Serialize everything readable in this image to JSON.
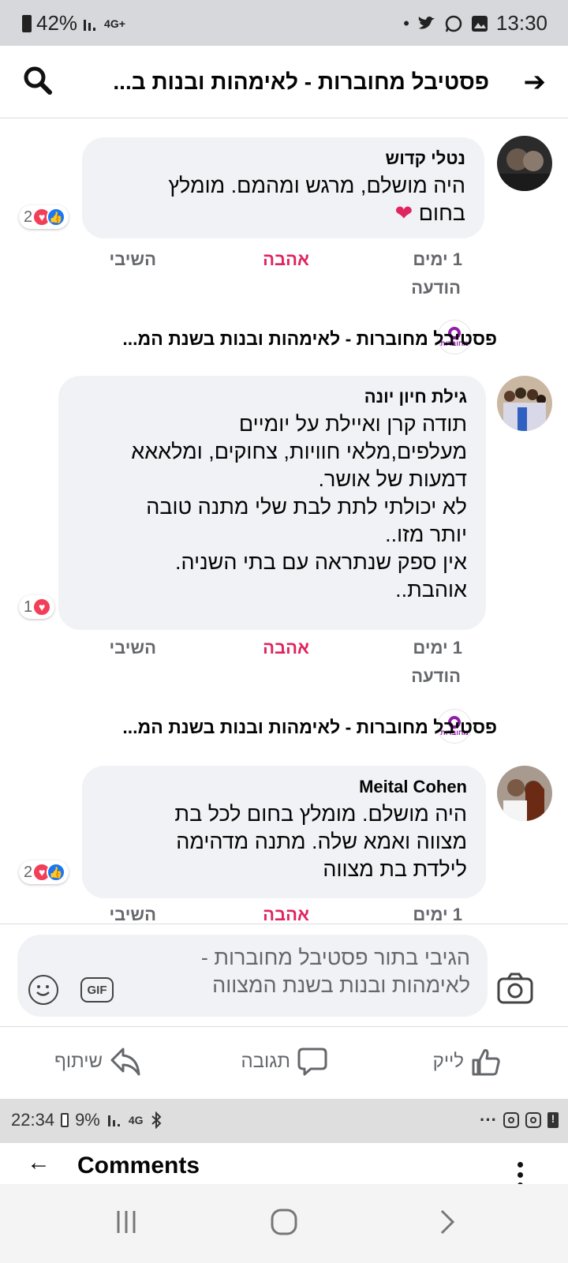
{
  "status_bar": {
    "battery": "42%",
    "network": "4G+",
    "time": "13:30"
  },
  "header": {
    "title": "פסטיבל מחוברות - לאימהות ובנות ב...",
    "back_icon": "arrow-right-icon",
    "search_icon": "search-icon"
  },
  "comments": [
    {
      "author": "נטלי קדוש",
      "text": "היה מושלם, מרגש ומהמם. מומלץ\nבחום",
      "has_heart_emoji": true,
      "reaction_count": "2",
      "reactions": [
        "heart",
        "like"
      ],
      "time": "1 ימים",
      "love_label": "אהבה",
      "reply_label": "השיבי",
      "message_label": "הודעה"
    },
    {
      "author": "גילת חיון יונה",
      "text": "תודה קרן ואיילת על יומיים\nמעלפים,מלאי חוויות, צחוקים, ומלאאא\nדמעות של אושר.\nלא יכולתי לתת לבת שלי מתנה טובה\nיותר מזו..\nאין ספק שנתראה עם בתי השניה.\nאוהבת..",
      "reaction_count": "1",
      "reactions": [
        "heart"
      ],
      "time": "1 ימים",
      "love_label": "אהבה",
      "reply_label": "השיבי",
      "message_label": "הודעה"
    },
    {
      "author": "Meital Cohen",
      "text": "היה מושלם. מומלץ בחום לכל בת\nמצווה ואמא שלה. מתנה מדהימה\nלילדת בת מצווה",
      "reaction_count": "2",
      "reactions": [
        "heart",
        "like"
      ],
      "time": "1 ימים",
      "love_label": "אהבה",
      "reply_label": "השיבי"
    }
  ],
  "page_reply_line": "פסטיבל מחוברות - לאימהות ובנות בשנת המ...",
  "page_logo_text": "מחוברות",
  "composer": {
    "placeholder": "הגיבי בתור פסטיבל מחוברות - לאימהות ובנות בשנת המצווה",
    "gif_label": "GIF"
  },
  "actions": {
    "like": "לייק",
    "comment": "תגובה",
    "share": "שיתוף"
  },
  "status_bar_2": {
    "time": "22:34",
    "battery": "9%",
    "network": "4G",
    "dots": "···"
  },
  "comments_screen": {
    "title": "Comments"
  },
  "colors": {
    "love": "#e0245e",
    "bubble_bg": "#f0f2f5",
    "like_blue": "#1877f2",
    "heart_red": "#f33e58"
  }
}
